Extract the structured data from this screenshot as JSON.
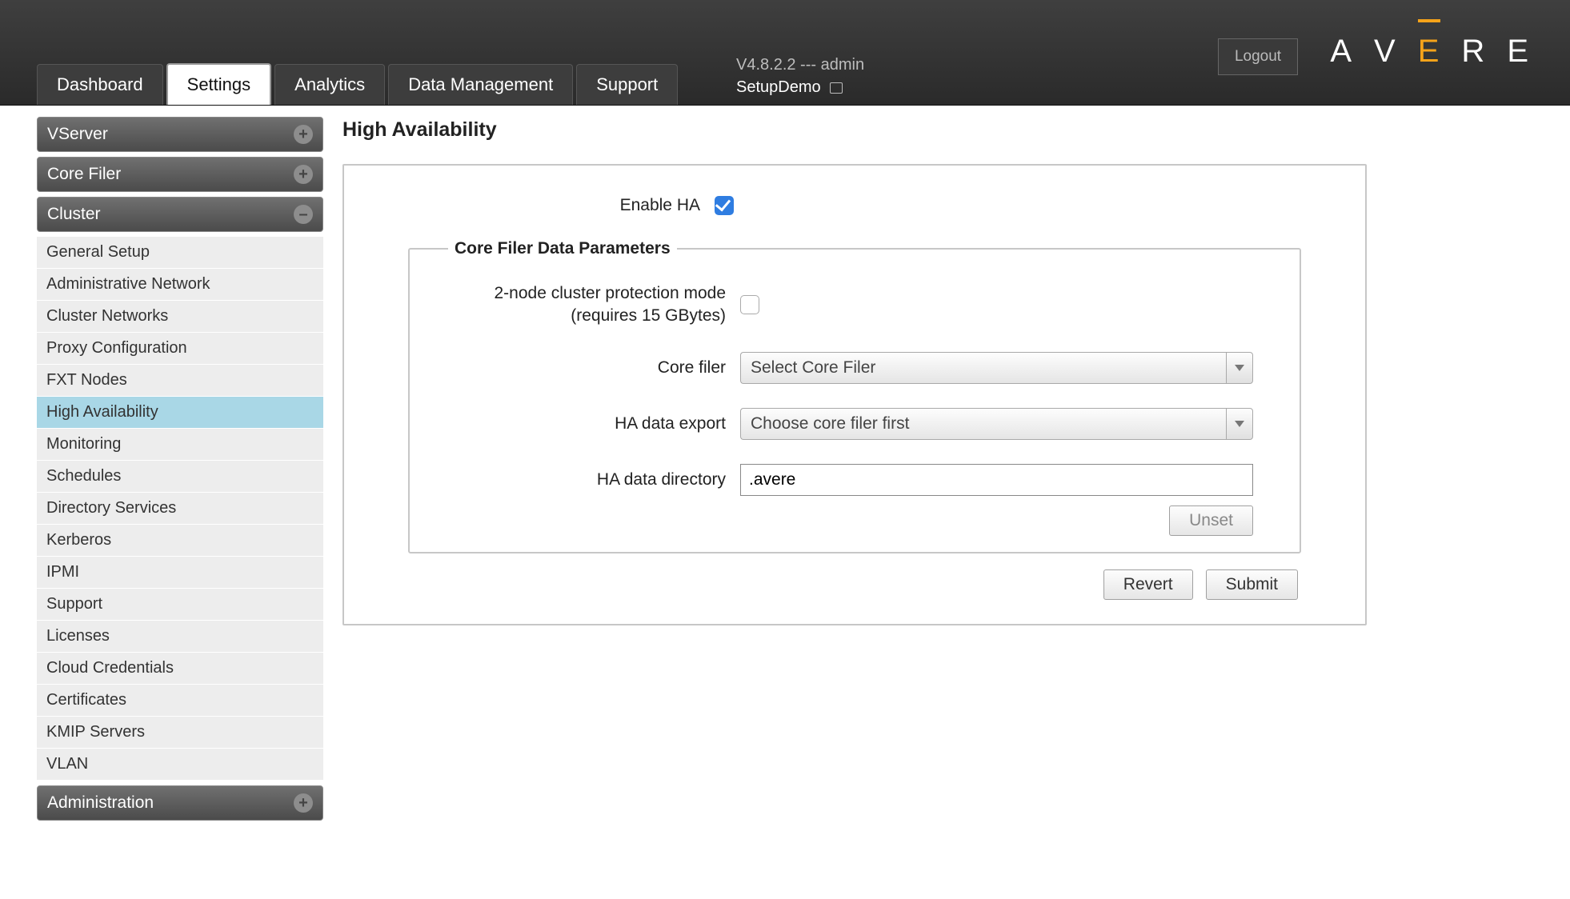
{
  "header": {
    "logout_label": "Logout",
    "logo_letters": [
      "A",
      "V",
      "E",
      "R",
      "E"
    ],
    "version_line": "V4.8.2.2 --- admin",
    "cluster_name": "SetupDemo"
  },
  "tabs": [
    {
      "label": "Dashboard"
    },
    {
      "label": "Settings",
      "active": true
    },
    {
      "label": "Analytics"
    },
    {
      "label": "Data Management"
    },
    {
      "label": "Support"
    }
  ],
  "sidebar": {
    "sections": {
      "vserver": {
        "label": "VServer",
        "expanded": false
      },
      "corefiler": {
        "label": "Core Filer",
        "expanded": false
      },
      "cluster": {
        "label": "Cluster",
        "expanded": true
      },
      "administration": {
        "label": "Administration",
        "expanded": false
      }
    },
    "cluster_items": [
      {
        "label": "General Setup"
      },
      {
        "label": "Administrative Network"
      },
      {
        "label": "Cluster Networks"
      },
      {
        "label": "Proxy Configuration"
      },
      {
        "label": "FXT Nodes"
      },
      {
        "label": "High Availability",
        "active": true
      },
      {
        "label": "Monitoring"
      },
      {
        "label": "Schedules"
      },
      {
        "label": "Directory Services"
      },
      {
        "label": "Kerberos"
      },
      {
        "label": "IPMI"
      },
      {
        "label": "Support"
      },
      {
        "label": "Licenses"
      },
      {
        "label": "Cloud Credentials"
      },
      {
        "label": "Certificates"
      },
      {
        "label": "KMIP Servers"
      },
      {
        "label": "VLAN"
      }
    ]
  },
  "page": {
    "title": "High Availability",
    "enable_ha_label": "Enable HA",
    "enable_ha_checked": true,
    "group_legend": "Core Filer Data Parameters",
    "twonode_label": "2-node cluster protection mode (requires 15 GBytes)",
    "twonode_checked": false,
    "corefiler_label": "Core filer",
    "corefiler_value": "Select Core Filer",
    "haexport_label": "HA data export",
    "haexport_value": "Choose core filer first",
    "hadir_label": "HA data directory",
    "hadir_value": ".avere",
    "unset_label": "Unset",
    "revert_label": "Revert",
    "submit_label": "Submit"
  }
}
